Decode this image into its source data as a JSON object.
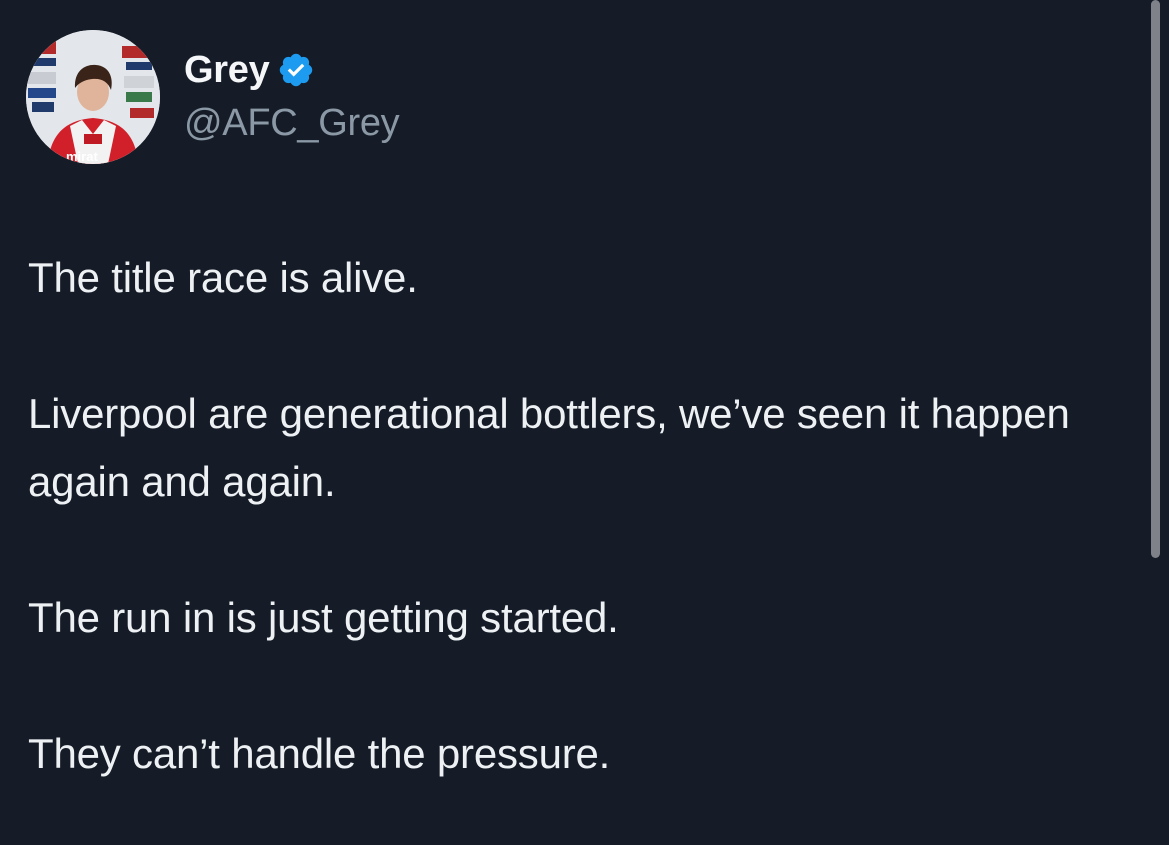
{
  "user": {
    "display_name": "Grey",
    "handle": "@AFC_Grey",
    "verified_icon": "verified-badge-icon",
    "avatar_icon": "profile-avatar"
  },
  "tweet": {
    "paragraphs": [
      "The title race is alive.",
      "Liverpool are generational bottlers, we’ve seen it happen again and again.",
      "The run in is just getting started.",
      "They can’t handle the pressure."
    ]
  },
  "colors": {
    "background": "#151c27",
    "text": "#eef1f4",
    "secondary_text": "#8b98a5",
    "verified": "#1d9bf0"
  }
}
